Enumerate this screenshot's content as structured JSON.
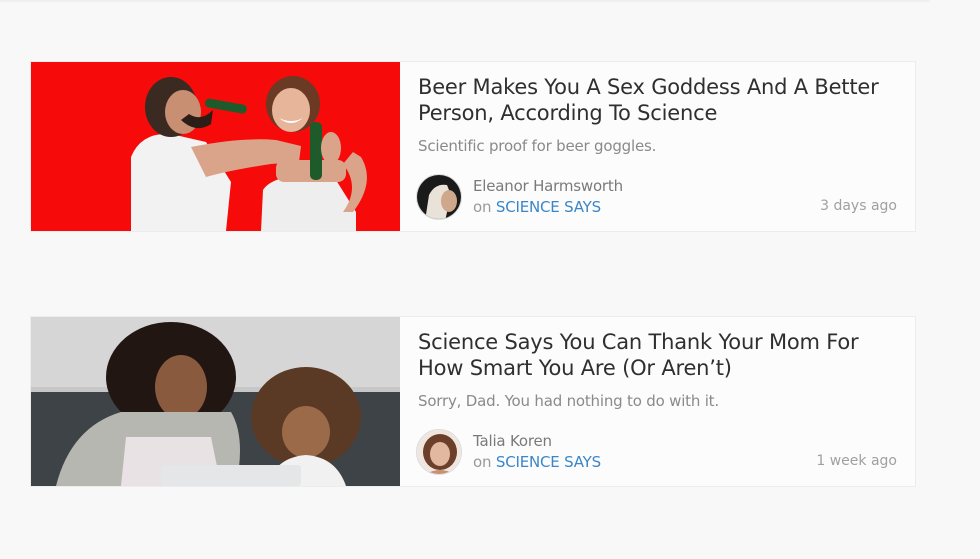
{
  "articles": [
    {
      "title": "Beer Makes You A Sex Goddess And A Better Person, According To Science",
      "dek": "Scientific proof for beer goggles.",
      "author": "Eleanor Harmsworth",
      "on_prefix": "on",
      "section": "SCIENCE SAYS",
      "time": "3 days ago",
      "image_bg": "#f70a0a"
    },
    {
      "title": "Science Says You Can Thank Your Mom For How Smart You Are (Or Aren’t)",
      "dek": "Sorry, Dad. You had nothing to do with it.",
      "author": "Talia Koren",
      "on_prefix": "on",
      "section": "SCIENCE SAYS",
      "time": "1 week ago",
      "image_bg": "#c9c9c9"
    }
  ],
  "colors": {
    "link": "#3a86c8",
    "title": "#2f2f2f",
    "muted": "#8a8a8a"
  }
}
